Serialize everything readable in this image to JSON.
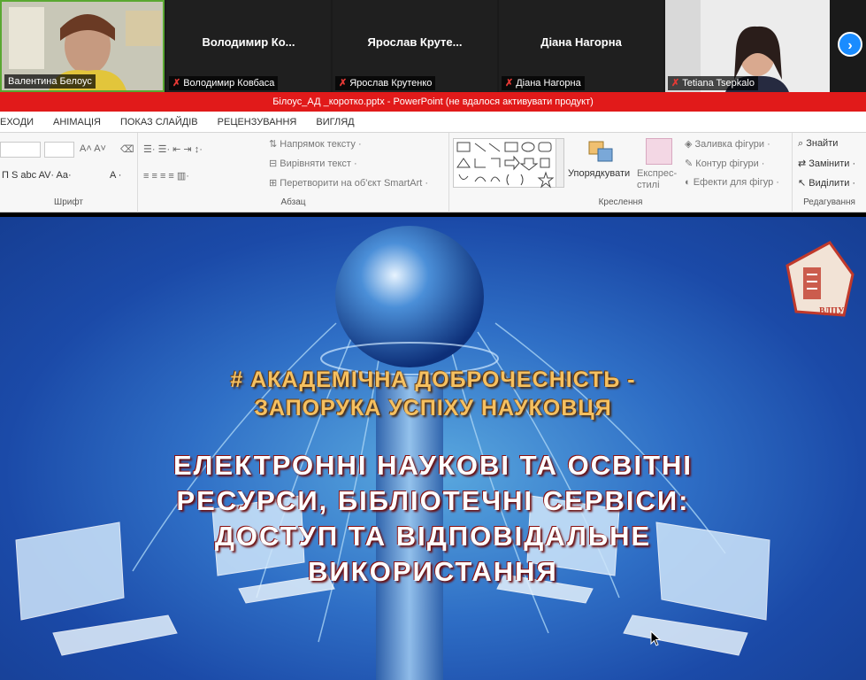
{
  "participants": [
    {
      "name": "Валентина Белоус",
      "display": "",
      "muted": false,
      "video": true,
      "active": true
    },
    {
      "name": "Володимир Ковбаса",
      "display": "Володимир  Ко...",
      "muted": true,
      "video": false,
      "active": false
    },
    {
      "name": "Ярослав Крутенко",
      "display": "Ярослав  Круте...",
      "muted": true,
      "video": false,
      "active": false
    },
    {
      "name": "Діана Нагорна",
      "display": "Діана Нагорна",
      "muted": true,
      "video": false,
      "active": false
    },
    {
      "name": "Tetiana Tsepkalo",
      "display": "",
      "muted": true,
      "video": true,
      "active": false
    }
  ],
  "next_icon": "chevron-right-icon",
  "window_title": "Білоус_АД _коротко.pptx -  PowerPoint (не вдалося активувати продукт)",
  "ribbon_tabs": [
    "ЕХОДИ",
    "АНІМАЦІЯ",
    "ПОКАЗ СЛАЙДІВ",
    "РЕЦЕНЗУВАННЯ",
    "ВИГЛЯД"
  ],
  "ribbon": {
    "font_group": "Шрифт",
    "paragraph_group": "Абзац",
    "drawing_group": "Креслення",
    "editing_group": "Редагування",
    "text_direction": "Напрямок тексту",
    "align_text": "Вирівняти текст",
    "smartart": "Перетворити на об'єкт SmartArt",
    "arrange": "Упорядкувати",
    "quick_styles": "Експрес-стилі",
    "fill": "Заливка фігури",
    "outline": "Контур фігури",
    "effects": "Ефекти для фігур",
    "find": "Знайти",
    "replace": "Замінити",
    "select": "Виділити"
  },
  "slide": {
    "heading_line1": "# АКАДЕМІЧНА ДОБРОЧЕСНІСТЬ -",
    "heading_line2": "ЗАПОРУКА УСПІХУ НАУКОВЦЯ",
    "title_lines": [
      "ЕЛЕКТРОННІ НАУКОВІ ТА ОСВІТНІ",
      "РЕСУРСИ, БІБЛІОТЕЧНІ СЕРВІСИ:",
      "ДОСТУП ТА ВІДПОВІДАЛЬНЕ",
      "ВИКОРИСТАННЯ"
    ],
    "logo_text": "ВДПУ"
  },
  "colors": {
    "titlebar": "#e11a1a",
    "active_border": "#5aa832",
    "next_button": "#1a8cff",
    "heading": "#f5c060"
  }
}
